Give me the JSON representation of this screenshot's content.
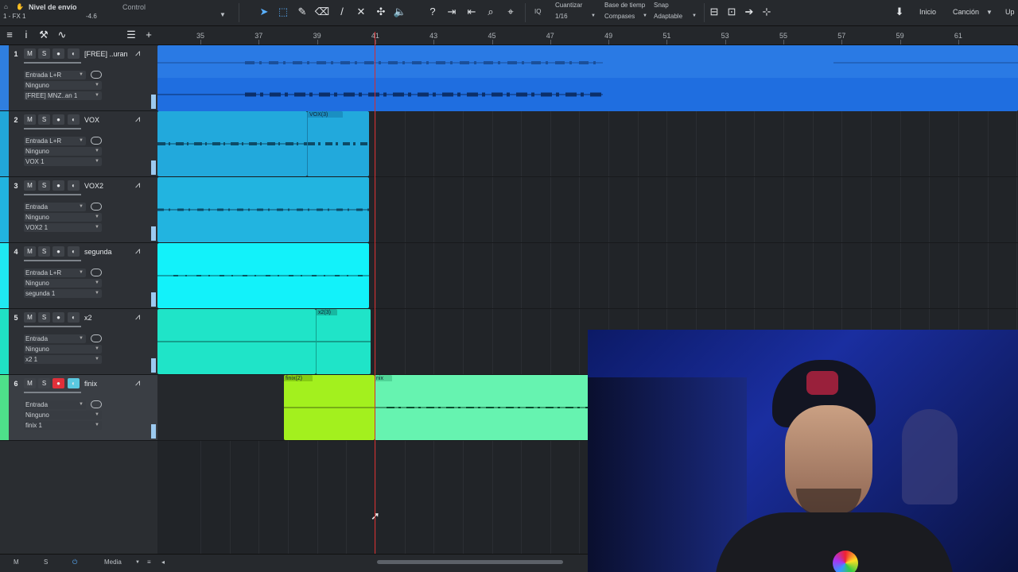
{
  "toolbar": {
    "send_level_label": "Nivel de envío",
    "fx_channel": "1 - FX 1",
    "send_value": "-4.6",
    "control_label": "Control",
    "quantize_label": "Cuantizar",
    "quantize_value": "1/16",
    "timebase_label": "Base de tiemp",
    "timebase_value": "Compases",
    "snap_label": "Snap",
    "snap_value": "Adaptable",
    "start_link": "Inicio",
    "song_link": "Canción",
    "upgrade_link": "Up"
  },
  "ruler": {
    "ticks": [
      "35",
      "37",
      "39",
      "41",
      "43",
      "45",
      "47",
      "49",
      "51",
      "53",
      "55",
      "57",
      "59",
      "61"
    ]
  },
  "tracks": [
    {
      "number": "1",
      "name": "[FREE] ..uran",
      "input": "Entrada L+R",
      "output": "Ninguno",
      "channel": "[FREE] MNZ..an 1",
      "color": "#2f7fe0"
    },
    {
      "number": "2",
      "name": "VOX",
      "input": "Entrada L+R",
      "output": "Ninguno",
      "channel": "VOX 1",
      "color": "#21a6d9"
    },
    {
      "number": "3",
      "name": "VOX2",
      "input": "Entrada",
      "output": "Ninguno",
      "channel": "VOX2 1",
      "color": "#21b3e0"
    },
    {
      "number": "4",
      "name": "segunda",
      "input": "Entrada L+R",
      "output": "Ninguno",
      "channel": "segunda 1",
      "color": "#1fe8f2"
    },
    {
      "number": "5",
      "name": "x2",
      "input": "Entrada",
      "output": "Ninguno",
      "channel": "x2 1",
      "color": "#20e0c4"
    },
    {
      "number": "6",
      "name": "finix",
      "input": "Entrada",
      "output": "Ninguno",
      "channel": "finix 1",
      "color": "#4ee08a"
    }
  ],
  "clips": {
    "vox_clip2": "VOX(3)",
    "x2_clip2": "x2(3)",
    "finix_clip1": "finix(2)",
    "finix_clip2": "nix"
  },
  "track_buttons": {
    "mute": "M",
    "solo": "S"
  },
  "bottombar": {
    "m": "M",
    "s": "S",
    "media": "Media"
  },
  "colors": {
    "playhead": "#d82b2b",
    "record": "#e0303a"
  }
}
